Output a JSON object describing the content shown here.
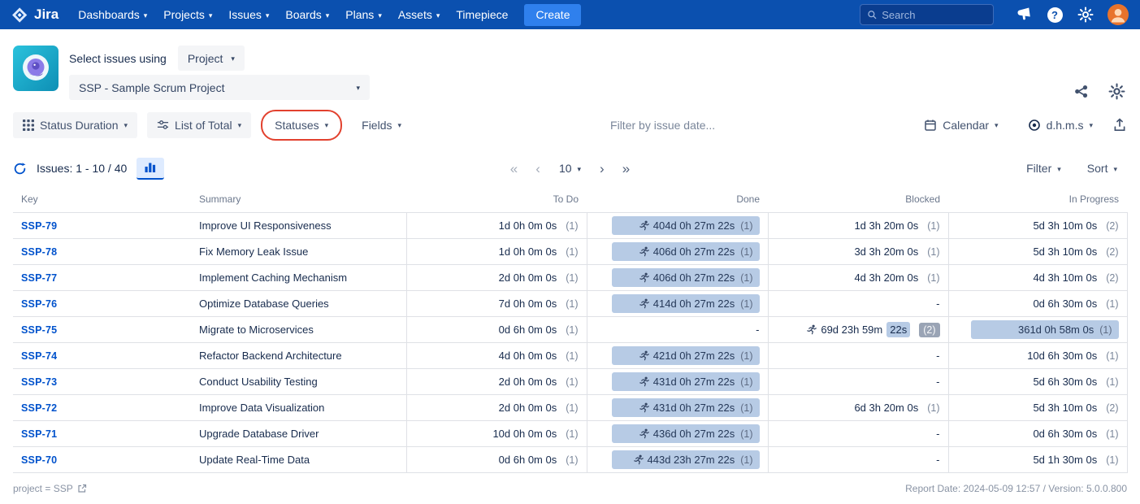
{
  "colors": {
    "navbar": "#0B50AF",
    "navbar_search_bg": "#0A3D8F",
    "create_button": "#2F80ED",
    "link": "#0052CC",
    "accent_blue": "#0052CC",
    "badge_blue": "#B7CBE5",
    "badge_gray": "#9AA4B5",
    "button_bg": "#F4F5F7",
    "text_primary": "#172B4D",
    "text_secondary": "#6B778C",
    "row_border": "#DFE1E6",
    "annotation_red": "#E2412E"
  },
  "icons": {
    "chevron_down": "▾",
    "first_page": "«",
    "prev_page": "‹",
    "next_page": "›",
    "last_page": "»",
    "empty_duration": "-"
  },
  "annotation": {
    "highlight": "Statuses",
    "color": "#E2412E"
  },
  "navbar": {
    "brand": "Jira",
    "items": [
      {
        "label": "Dashboards",
        "chevron": true
      },
      {
        "label": "Projects",
        "chevron": true
      },
      {
        "label": "Issues",
        "chevron": true
      },
      {
        "label": "Boards",
        "chevron": true
      },
      {
        "label": "Plans",
        "chevron": true
      },
      {
        "label": "Assets",
        "chevron": true
      },
      {
        "label": "Timepiece",
        "chevron": false
      }
    ],
    "create_label": "Create",
    "search_placeholder": "Search"
  },
  "header": {
    "select_issues_label": "Select issues using",
    "issue_source": "Project",
    "project": "SSP - Sample Scrum Project"
  },
  "toolbar": {
    "report_type": "Status Duration",
    "list_mode": "List of Total",
    "statuses_label": "Statuses",
    "fields_label": "Fields",
    "date_filter_placeholder": "Filter by issue date...",
    "calendar_label": "Calendar",
    "duration_format": "d.h.m.s"
  },
  "pagination": {
    "issues_range": "Issues: 1 - 10 / 40",
    "page_size": "10",
    "filter_label": "Filter",
    "sort_label": "Sort"
  },
  "table": {
    "columns": [
      "Key",
      "Summary",
      "To Do",
      "Done",
      "Blocked",
      "In Progress"
    ],
    "rows": [
      {
        "key": "SSP-79",
        "summary": "Improve UI Responsiveness",
        "todo": {
          "text": "1d 0h 0m 0s",
          "count": "(1)"
        },
        "done": {
          "pill": true,
          "runner": true,
          "text": "404d 0h 27m 22s",
          "count": "(1)"
        },
        "blocked": {
          "text": "1d 3h 20m 0s",
          "count": "(1)"
        },
        "inprogress": {
          "text": "5d 3h 10m 0s",
          "count": "(2)"
        }
      },
      {
        "key": "SSP-78",
        "summary": "Fix Memory Leak Issue",
        "todo": {
          "text": "1d 0h 0m 0s",
          "count": "(1)"
        },
        "done": {
          "pill": true,
          "runner": true,
          "text": "406d 0h 27m 22s",
          "count": "(1)"
        },
        "blocked": {
          "text": "3d 3h 20m 0s",
          "count": "(1)"
        },
        "inprogress": {
          "text": "5d 3h 10m 0s",
          "count": "(2)"
        }
      },
      {
        "key": "SSP-77",
        "summary": "Implement Caching Mechanism",
        "todo": {
          "text": "2d 0h 0m 0s",
          "count": "(1)"
        },
        "done": {
          "pill": true,
          "runner": true,
          "text": "406d 0h 27m 22s",
          "count": "(1)"
        },
        "blocked": {
          "text": "4d 3h 20m 0s",
          "count": "(1)"
        },
        "inprogress": {
          "text": "4d 3h 10m 0s",
          "count": "(2)"
        }
      },
      {
        "key": "SSP-76",
        "summary": "Optimize Database Queries",
        "todo": {
          "text": "7d 0h 0m 0s",
          "count": "(1)"
        },
        "done": {
          "pill": true,
          "runner": true,
          "text": "414d 0h 27m 22s",
          "count": "(1)"
        },
        "blocked": {
          "dash": true
        },
        "inprogress": {
          "text": "0d 6h 30m 0s",
          "count": "(1)"
        }
      },
      {
        "key": "SSP-75",
        "summary": "Migrate to Microservices",
        "todo": {
          "text": "0d 6h 0m 0s",
          "count": "(1)"
        },
        "done": {
          "dash": true
        },
        "blocked": {
          "runner": true,
          "text": "69d 23h 59m",
          "hl": "22s",
          "count": "(2)",
          "count_gray": true
        },
        "inprogress": {
          "pill": true,
          "text": "361d 0h 58m 0s",
          "count": "(1)"
        }
      },
      {
        "key": "SSP-74",
        "summary": "Refactor Backend Architecture",
        "todo": {
          "text": "4d 0h 0m 0s",
          "count": "(1)"
        },
        "done": {
          "pill": true,
          "runner": true,
          "text": "421d 0h 27m 22s",
          "count": "(1)"
        },
        "blocked": {
          "dash": true
        },
        "inprogress": {
          "text": "10d 6h 30m 0s",
          "count": "(1)"
        }
      },
      {
        "key": "SSP-73",
        "summary": "Conduct Usability Testing",
        "todo": {
          "text": "2d 0h 0m 0s",
          "count": "(1)"
        },
        "done": {
          "pill": true,
          "runner": true,
          "text": "431d 0h 27m 22s",
          "count": "(1)"
        },
        "blocked": {
          "dash": true
        },
        "inprogress": {
          "text": "5d 6h 30m 0s",
          "count": "(1)"
        }
      },
      {
        "key": "SSP-72",
        "summary": "Improve Data Visualization",
        "todo": {
          "text": "2d 0h 0m 0s",
          "count": "(1)"
        },
        "done": {
          "pill": true,
          "runner": true,
          "text": "431d 0h 27m 22s",
          "count": "(1)"
        },
        "blocked": {
          "text": "6d 3h 20m 0s",
          "count": "(1)"
        },
        "inprogress": {
          "text": "5d 3h 10m 0s",
          "count": "(2)"
        }
      },
      {
        "key": "SSP-71",
        "summary": "Upgrade Database Driver",
        "todo": {
          "text": "10d 0h 0m 0s",
          "count": "(1)"
        },
        "done": {
          "pill": true,
          "runner": true,
          "text": "436d 0h 27m 22s",
          "count": "(1)"
        },
        "blocked": {
          "dash": true
        },
        "inprogress": {
          "text": "0d 6h 30m 0s",
          "count": "(1)"
        }
      },
      {
        "key": "SSP-70",
        "summary": "Update Real-Time Data",
        "todo": {
          "text": "0d 6h 0m 0s",
          "count": "(1)"
        },
        "done": {
          "pill": true,
          "runner": true,
          "text": "443d 23h 27m 22s",
          "count": "(1)"
        },
        "blocked": {
          "dash": true
        },
        "inprogress": {
          "text": "5d 1h 30m 0s",
          "count": "(1)"
        }
      }
    ]
  },
  "footer": {
    "jql": "project = SSP",
    "report_info": "Report Date: 2024-05-09 12:57 / Version: 5.0.0.800"
  }
}
